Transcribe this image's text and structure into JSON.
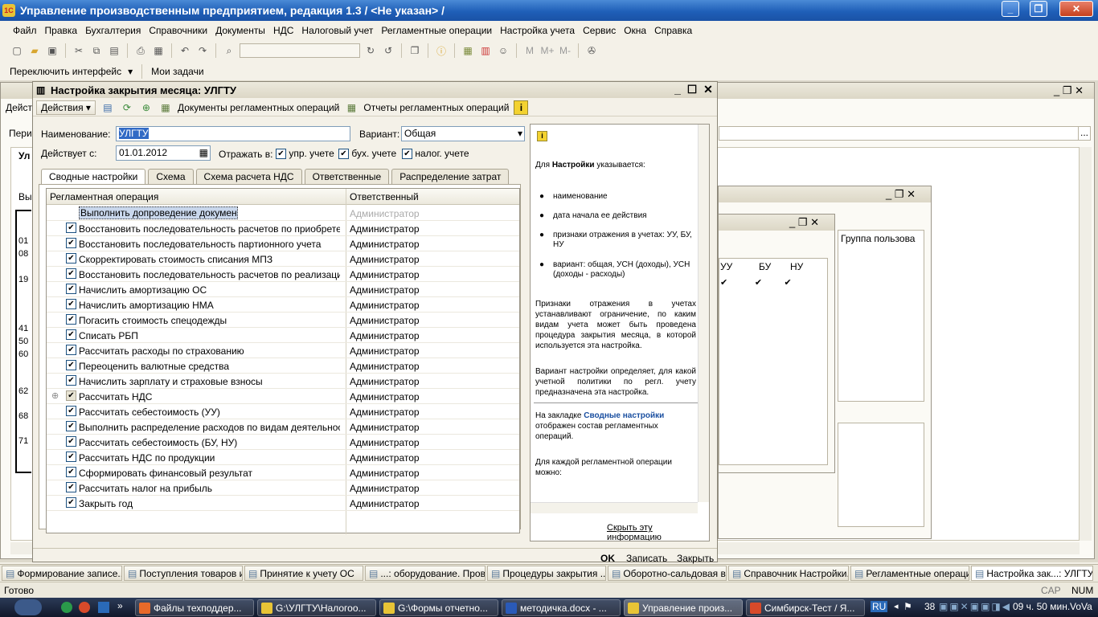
{
  "app": {
    "title": "Управление производственным предприятием, редакция 1.3 / <Не указан> /",
    "logo": "1С"
  },
  "menu": [
    "Файл",
    "Правка",
    "Бухгалтерия",
    "Справочники",
    "Документы",
    "НДС",
    "Налоговый учет",
    "Регламентные операции",
    "Настройка учета",
    "Сервис",
    "Окна",
    "Справка"
  ],
  "toolbar2": {
    "switch": "Переключить интерфейс",
    "tasks": "Мои задачи"
  },
  "dialog": {
    "title": "Настройка закрытия месяца: УЛГТУ",
    "actions": "Действия",
    "btn_docs": "Документы регламентных операций",
    "btn_reports": "Отчеты регламентных операций",
    "name_label": "Наименование:",
    "name_value": "УЛГТУ",
    "variant_label": "Вариант:",
    "variant_value": "Общая",
    "date_label": "Действует с:",
    "date_value": "01.01.2012",
    "reflect_label": "Отражать в:",
    "chk_upr": "упр. учете",
    "chk_buh": "бух. учете",
    "chk_nal": "налог. учете",
    "tabs": [
      "Сводные настройки",
      "Схема",
      "Схема расчета НДС",
      "Ответственные",
      "Распределение затрат"
    ],
    "col_op": "Регламентная операция",
    "col_resp": "Ответственный",
    "rows": [
      {
        "op": "Выполнить допроведение документов",
        "resp": "Администратор"
      },
      {
        "op": "Восстановить последовательность расчетов по приобретению",
        "resp": "Администратор"
      },
      {
        "op": "Восстановить последовательность партионного учета",
        "resp": "Администратор"
      },
      {
        "op": "Скорректировать стоимость списания МПЗ",
        "resp": "Администратор"
      },
      {
        "op": "Восстановить последовательность расчетов по реализации",
        "resp": "Администратор"
      },
      {
        "op": "Начислить амортизацию ОС",
        "resp": "Администратор"
      },
      {
        "op": "Начислить амортизацию НМА",
        "resp": "Администратор"
      },
      {
        "op": "Погасить стоимость спецодежды",
        "resp": "Администратор"
      },
      {
        "op": "Списать РБП",
        "resp": "Администратор"
      },
      {
        "op": "Рассчитать расходы по страхованию",
        "resp": "Администратор"
      },
      {
        "op": "Переоценить валютные средства",
        "resp": "Администратор"
      },
      {
        "op": "Начислить зарплату и страховые взносы",
        "resp": "Администратор"
      },
      {
        "op": "Рассчитать НДС",
        "resp": "Администратор"
      },
      {
        "op": "Рассчитать себестоимость (УУ)",
        "resp": "Администратор"
      },
      {
        "op": "Выполнить распределение расходов по видам деятельности, ...",
        "resp": "Администратор"
      },
      {
        "op": "Рассчитать себестоимость (БУ, НУ)",
        "resp": "Администратор"
      },
      {
        "op": "Рассчитать НДС по продукции",
        "resp": "Администратор"
      },
      {
        "op": "Сформировать финансовый результат",
        "resp": "Администратор"
      },
      {
        "op": "Рассчитать налог на прибыль",
        "resp": "Администратор"
      },
      {
        "op": "Закрыть год",
        "resp": "Администратор"
      }
    ],
    "help": {
      "p1a": "Для ",
      "p1b": "Настройки",
      "p1c": " указывается:",
      "li1": "наименование",
      "li2": "дата начала ее действия",
      "li3": "признаки отражения в учетах: УУ, БУ, НУ",
      "li4": "вариант: общая, УСН (доходы), УСН (доходы - расходы)",
      "p2": "Признаки отражения в учетах устанавливают ограничение, по каким видам учета может быть проведена процедура закрытия месяца, в которой используется эта настройка.",
      "p3": "Вариант настройки определяет, для какой учетной политики по регл. учету предназначена эта настройка.",
      "p4a": "На закладке ",
      "p4b": "Сводные настройки",
      "p4c": " отображен состав регламентных операций.",
      "p5": "Для каждой регламентной операции можно:",
      "hide": "Скрыть эту информацию"
    },
    "ok": "OK",
    "save": "Записать",
    "close": "Закрыть"
  },
  "bg": {
    "act": "Дейст",
    "peri": "Пери",
    "ul": "Ул",
    "vy": "Вы",
    "nums": [
      "01",
      "08",
      "19",
      "41",
      "50",
      "60",
      "62",
      "68",
      "71"
    ],
    "group_header": "Группа пользова",
    "cols": [
      "УУ",
      "БУ",
      "НУ"
    ]
  },
  "taskbar_1c": [
    "Формирование записе...",
    "Поступления товаров и...",
    "Принятие к учету ОС",
    "...: оборудование. Пров...",
    "Процедуры закрытия ...",
    "Оборотно-сальдовая в...",
    "Справочник Настройки...",
    "Регламентные операции",
    "Настройка зак...: УЛГТУ"
  ],
  "status": {
    "ready": "Готово",
    "cap": "CAP",
    "num": "NUM"
  },
  "win_taskbar": {
    "items": [
      "Файлы техподдер...",
      "G:\\УЛГТУ\\Налогоо...",
      "G:\\Формы отчетно...",
      "методичка.docx - ...",
      "Управление произ...",
      "Симбирск-Тест / Я..."
    ],
    "lang": "RU",
    "count": "38",
    "clock": "09 ч. 50 мин.",
    "user": "VoVa"
  }
}
